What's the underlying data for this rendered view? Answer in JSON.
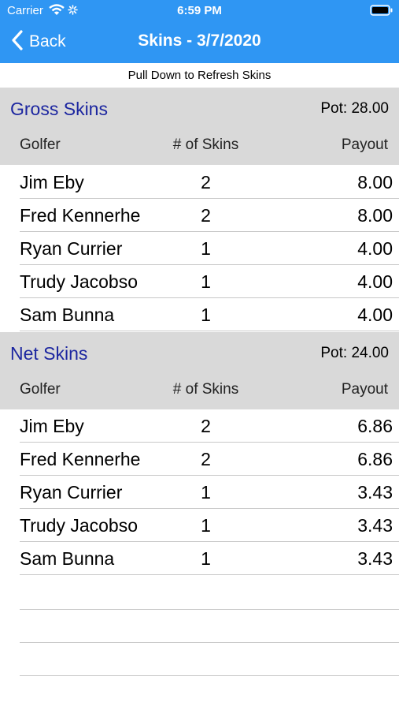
{
  "status_bar": {
    "carrier": "Carrier",
    "time": "6:59 PM"
  },
  "nav": {
    "back_label": "Back",
    "title": "Skins - 3/7/2020"
  },
  "refresh_hint": "Pull Down to Refresh Skins",
  "columns": {
    "golfer": "Golfer",
    "skins": "# of Skins",
    "payout": "Payout"
  },
  "gross": {
    "title": "Gross Skins",
    "pot": "Pot: 28.00",
    "rows": [
      {
        "golfer": "Jim Eby",
        "skins": "2",
        "payout": "8.00"
      },
      {
        "golfer": "Fred Kennerhe",
        "skins": "2",
        "payout": "8.00"
      },
      {
        "golfer": "Ryan Currier",
        "skins": "1",
        "payout": "4.00"
      },
      {
        "golfer": "Trudy Jacobso",
        "skins": "1",
        "payout": "4.00"
      },
      {
        "golfer": "Sam  Bunna",
        "skins": "1",
        "payout": "4.00"
      }
    ]
  },
  "net": {
    "title": "Net Skins",
    "pot": "Pot: 24.00",
    "rows": [
      {
        "golfer": "Jim Eby",
        "skins": "2",
        "payout": "6.86"
      },
      {
        "golfer": "Fred Kennerhe",
        "skins": "2",
        "payout": "6.86"
      },
      {
        "golfer": "Ryan Currier",
        "skins": "1",
        "payout": "3.43"
      },
      {
        "golfer": "Trudy Jacobso",
        "skins": "1",
        "payout": "3.43"
      },
      {
        "golfer": "Sam  Bunna",
        "skins": "1",
        "payout": "3.43"
      }
    ]
  },
  "colors": {
    "nav_bar": "#2f96f3",
    "section_header": "#d9d9d9",
    "section_title": "#1c26a0"
  },
  "icons": [
    "wifi-icon",
    "activity-spinner-icon",
    "battery-icon",
    "chevron-left-icon"
  ]
}
